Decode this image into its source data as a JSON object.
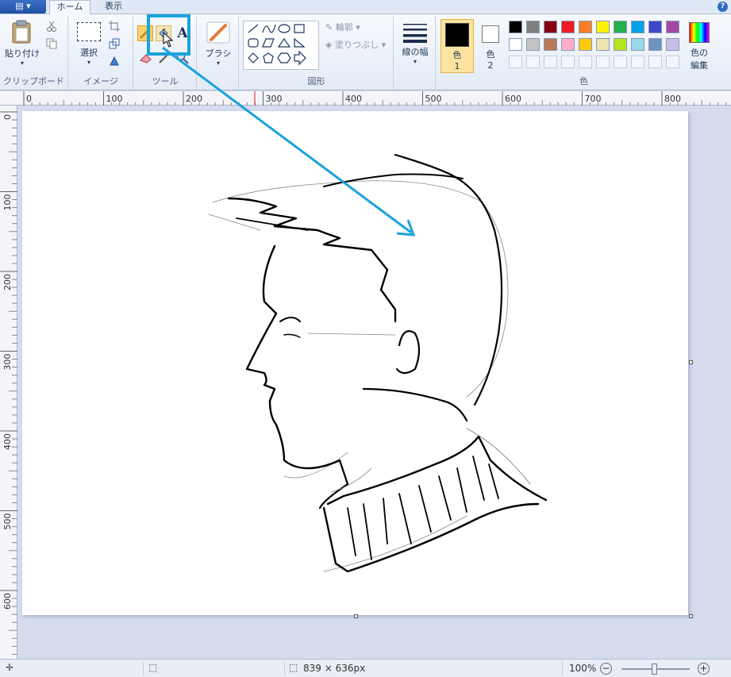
{
  "tabs": {
    "menu_glyph": "▤ ▾",
    "home": "ホーム",
    "view": "表示"
  },
  "ribbon": {
    "clipboard": {
      "label": "クリップボード",
      "paste": "貼り付け"
    },
    "image": {
      "label": "イメージ",
      "select": "選択"
    },
    "tools": {
      "label": "ツール",
      "text_glyph": "A"
    },
    "brushes": {
      "label": "ブラシ"
    },
    "shapes": {
      "label": "図形",
      "outline": "輪郭",
      "fill": "塗りつぶし"
    },
    "size": {
      "label": "線の幅"
    },
    "colors": {
      "label": "色",
      "color1_label": "色",
      "color1_num": "1",
      "color2_label": "色",
      "color2_num": "2",
      "edit_label1": "色の",
      "edit_label2": "編集",
      "color1": "#000000",
      "color2": "#ffffff",
      "palette_row1": [
        "#000000",
        "#7f7f7f",
        "#880015",
        "#ed1c24",
        "#ff7f27",
        "#fff200",
        "#22b14c",
        "#00a2e8",
        "#3f48cc",
        "#a349a4"
      ],
      "palette_row2": [
        "#ffffff",
        "#c3c3c3",
        "#b97a57",
        "#ffaec9",
        "#ffc90e",
        "#efe4b0",
        "#b5e61d",
        "#99d9ea",
        "#7092be",
        "#c8bfe7"
      ]
    }
  },
  "ruler": {
    "top": [
      "0",
      "100",
      "200",
      "300",
      "400",
      "500",
      "600",
      "700",
      "800"
    ],
    "left": [
      "0",
      "100",
      "200",
      "300",
      "400",
      "500",
      "600"
    ]
  },
  "status": {
    "dimensions": "839 × 636px",
    "zoom": "100%"
  },
  "accent": "#1aa2dc"
}
